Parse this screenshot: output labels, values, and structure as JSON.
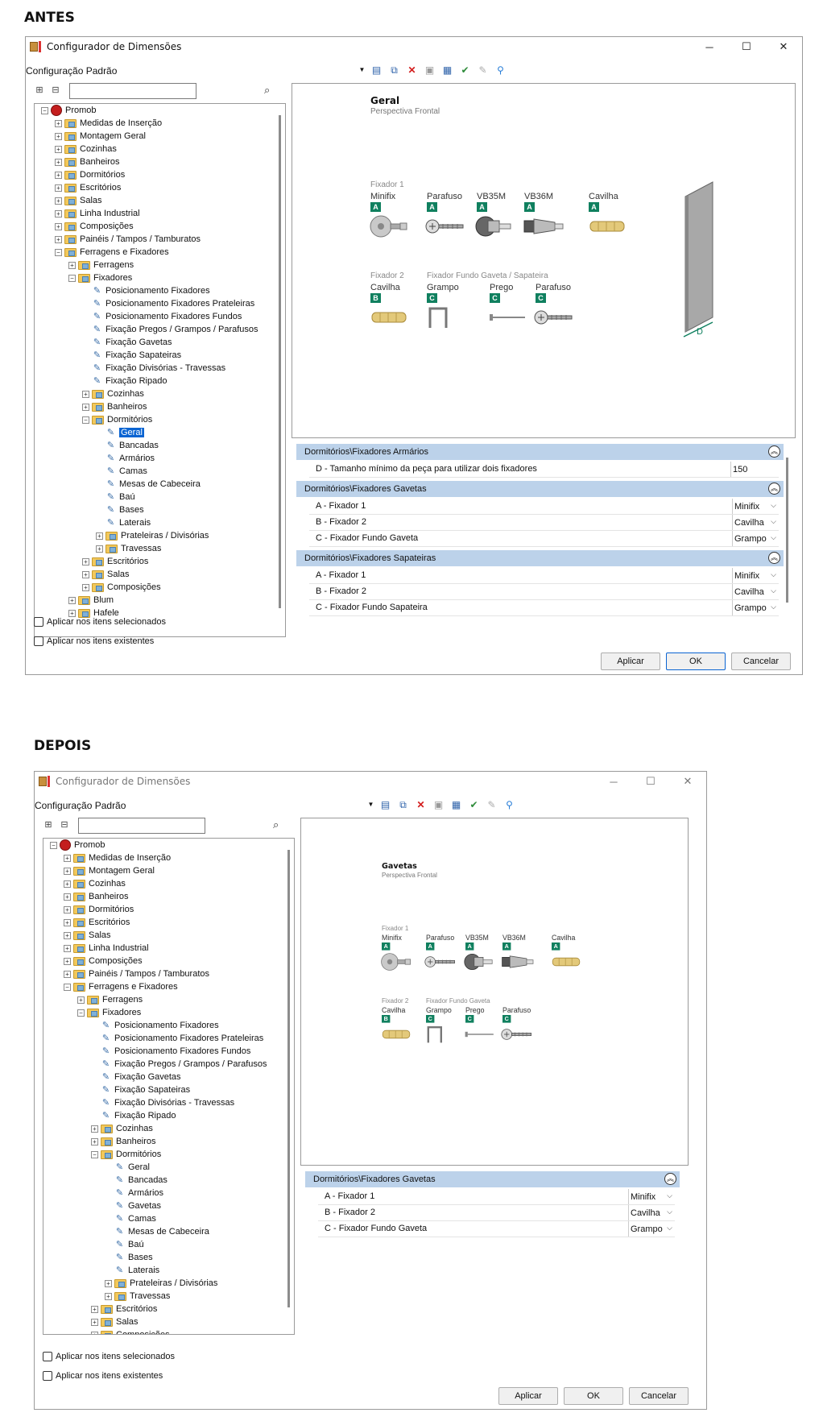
{
  "labels": {
    "before": "ANTES",
    "after": "DEPOIS"
  },
  "before": {
    "title": "Configurador de Dimensões",
    "config": "Configuração Padrão",
    "tree": [
      {
        "label": "Promob",
        "level": 0,
        "icon": "root",
        "exp": "-"
      },
      {
        "label": "Medidas de Inserção",
        "level": 1,
        "icon": "folder",
        "exp": "+"
      },
      {
        "label": "Montagem Geral",
        "level": 1,
        "icon": "folder",
        "exp": "+"
      },
      {
        "label": "Cozinhas",
        "level": 1,
        "icon": "folder",
        "exp": "+"
      },
      {
        "label": "Banheiros",
        "level": 1,
        "icon": "folder",
        "exp": "+"
      },
      {
        "label": "Dormitórios",
        "level": 1,
        "icon": "folder",
        "exp": "+"
      },
      {
        "label": "Escritórios",
        "level": 1,
        "icon": "folder",
        "exp": "+"
      },
      {
        "label": "Salas",
        "level": 1,
        "icon": "folder",
        "exp": "+"
      },
      {
        "label": "Linha Industrial",
        "level": 1,
        "icon": "folder",
        "exp": "+"
      },
      {
        "label": "Composições",
        "level": 1,
        "icon": "folder",
        "exp": "+"
      },
      {
        "label": "Painéis / Tampos / Tamburatos",
        "level": 1,
        "icon": "folder",
        "exp": "+"
      },
      {
        "label": "Ferragens e Fixadores",
        "level": 1,
        "icon": "folder",
        "exp": "-"
      },
      {
        "label": "Ferragens",
        "level": 2,
        "icon": "folder",
        "exp": "+"
      },
      {
        "label": "Fixadores",
        "level": 2,
        "icon": "folder",
        "exp": "-"
      },
      {
        "label": "Posicionamento Fixadores",
        "level": 3,
        "icon": "clip"
      },
      {
        "label": "Posicionamento Fixadores Prateleiras",
        "level": 3,
        "icon": "clip"
      },
      {
        "label": "Posicionamento Fixadores Fundos",
        "level": 3,
        "icon": "clip"
      },
      {
        "label": "Fixação Pregos / Grampos / Parafusos",
        "level": 3,
        "icon": "clip"
      },
      {
        "label": "Fixação Gavetas",
        "level": 3,
        "icon": "clip"
      },
      {
        "label": "Fixação Sapateiras",
        "level": 3,
        "icon": "clip"
      },
      {
        "label": "Fixação Divisórias - Travessas",
        "level": 3,
        "icon": "clip"
      },
      {
        "label": "Fixação Ripado",
        "level": 3,
        "icon": "clip"
      },
      {
        "label": "Cozinhas",
        "level": 3,
        "icon": "folder",
        "exp": "+"
      },
      {
        "label": "Banheiros",
        "level": 3,
        "icon": "folder",
        "exp": "+"
      },
      {
        "label": "Dormitórios",
        "level": 3,
        "icon": "folder",
        "exp": "-"
      },
      {
        "label": "Geral",
        "level": 4,
        "icon": "clip",
        "selected": true
      },
      {
        "label": "Bancadas",
        "level": 4,
        "icon": "clip"
      },
      {
        "label": "Armários",
        "level": 4,
        "icon": "clip"
      },
      {
        "label": "Camas",
        "level": 4,
        "icon": "clip"
      },
      {
        "label": "Mesas de Cabeceira",
        "level": 4,
        "icon": "clip"
      },
      {
        "label": "Baú",
        "level": 4,
        "icon": "clip"
      },
      {
        "label": "Bases",
        "level": 4,
        "icon": "clip"
      },
      {
        "label": "Laterais",
        "level": 4,
        "icon": "clip"
      },
      {
        "label": "Prateleiras / Divisórias",
        "level": 4,
        "icon": "folder",
        "exp": "+"
      },
      {
        "label": "Travessas",
        "level": 4,
        "icon": "folder",
        "exp": "+"
      },
      {
        "label": "Escritórios",
        "level": 3,
        "icon": "folder",
        "exp": "+"
      },
      {
        "label": "Salas",
        "level": 3,
        "icon": "folder",
        "exp": "+"
      },
      {
        "label": "Composições",
        "level": 3,
        "icon": "folder",
        "exp": "+"
      },
      {
        "label": "Blum",
        "level": 2,
        "icon": "folder",
        "exp": "+"
      },
      {
        "label": "Hafele",
        "level": 2,
        "icon": "folder",
        "exp": "+"
      }
    ],
    "chk1": "Aplicar nos itens selecionados",
    "chk2": "Aplicar nos itens existentes",
    "preview": {
      "title": "Geral",
      "subtitle": "Perspectiva Frontal",
      "row1": [
        {
          "top": "Fixador 1",
          "name": "Minifix",
          "badge": "A",
          "part": "minifix"
        },
        {
          "name": "Parafuso",
          "badge": "A",
          "part": "screw"
        },
        {
          "name": "VB35M",
          "badge": "A",
          "part": "vb35"
        },
        {
          "name": "VB36M",
          "badge": "A",
          "part": "vb36"
        },
        {
          "name": "Cavilha",
          "badge": "A",
          "part": "dowel"
        }
      ],
      "row2_header": "Fixador Fundo Gaveta / Sapateira",
      "row2": [
        {
          "top": "Fixador 2",
          "name": "Cavilha",
          "badge": "B",
          "part": "dowel"
        },
        {
          "name": "Grampo",
          "badge": "C",
          "part": "staple"
        },
        {
          "name": "Prego",
          "badge": "C",
          "part": "nail"
        },
        {
          "name": "Parafuso",
          "badge": "C",
          "part": "screw"
        }
      ],
      "dim_label": "D"
    },
    "groups": [
      {
        "title": "Dormitórios\\Fixadores Armários",
        "rows": [
          {
            "name": "D - Tamanho mínimo da peça para utilizar dois fixadores",
            "value": "150",
            "dropdown": false
          }
        ]
      },
      {
        "title": "Dormitórios\\Fixadores Gavetas",
        "rows": [
          {
            "name": "A - Fixador 1",
            "value": "Minifix",
            "dropdown": true
          },
          {
            "name": "B - Fixador 2",
            "value": "Cavilha",
            "dropdown": true
          },
          {
            "name": "C - Fixador Fundo Gaveta",
            "value": "Grampo",
            "dropdown": true
          }
        ]
      },
      {
        "title": "Dormitórios\\Fixadores Sapateiras",
        "rows": [
          {
            "name": "A - Fixador 1",
            "value": "Minifix",
            "dropdown": true
          },
          {
            "name": "B - Fixador 2",
            "value": "Cavilha",
            "dropdown": true
          },
          {
            "name": "C - Fixador Fundo Sapateira",
            "value": "Grampo",
            "dropdown": true
          }
        ]
      }
    ],
    "buttons": {
      "apply": "Aplicar",
      "ok": "OK",
      "cancel": "Cancelar"
    }
  },
  "after": {
    "title": "Configurador de Dimensões",
    "config": "Configuração Padrão",
    "tree": [
      {
        "label": "Promob",
        "level": 0,
        "icon": "root",
        "exp": "-"
      },
      {
        "label": "Medidas de Inserção",
        "level": 1,
        "icon": "folder",
        "exp": "+"
      },
      {
        "label": "Montagem Geral",
        "level": 1,
        "icon": "folder",
        "exp": "+"
      },
      {
        "label": "Cozinhas",
        "level": 1,
        "icon": "folder",
        "exp": "+"
      },
      {
        "label": "Banheiros",
        "level": 1,
        "icon": "folder",
        "exp": "+"
      },
      {
        "label": "Dormitórios",
        "level": 1,
        "icon": "folder",
        "exp": "+"
      },
      {
        "label": "Escritórios",
        "level": 1,
        "icon": "folder",
        "exp": "+"
      },
      {
        "label": "Salas",
        "level": 1,
        "icon": "folder",
        "exp": "+"
      },
      {
        "label": "Linha Industrial",
        "level": 1,
        "icon": "folder",
        "exp": "+"
      },
      {
        "label": "Composições",
        "level": 1,
        "icon": "folder",
        "exp": "+"
      },
      {
        "label": "Painéis / Tampos / Tamburatos",
        "level": 1,
        "icon": "folder",
        "exp": "+"
      },
      {
        "label": "Ferragens e Fixadores",
        "level": 1,
        "icon": "folder",
        "exp": "-"
      },
      {
        "label": "Ferragens",
        "level": 2,
        "icon": "folder",
        "exp": "+"
      },
      {
        "label": "Fixadores",
        "level": 2,
        "icon": "folder",
        "exp": "-"
      },
      {
        "label": "Posicionamento Fixadores",
        "level": 3,
        "icon": "clip"
      },
      {
        "label": "Posicionamento Fixadores Prateleiras",
        "level": 3,
        "icon": "clip"
      },
      {
        "label": "Posicionamento Fixadores Fundos",
        "level": 3,
        "icon": "clip"
      },
      {
        "label": "Fixação Pregos / Grampos / Parafusos",
        "level": 3,
        "icon": "clip"
      },
      {
        "label": "Fixação Gavetas",
        "level": 3,
        "icon": "clip"
      },
      {
        "label": "Fixação Sapateiras",
        "level": 3,
        "icon": "clip"
      },
      {
        "label": "Fixação Divisórias - Travessas",
        "level": 3,
        "icon": "clip"
      },
      {
        "label": "Fixação Ripado",
        "level": 3,
        "icon": "clip"
      },
      {
        "label": "Cozinhas",
        "level": 3,
        "icon": "folder",
        "exp": "+"
      },
      {
        "label": "Banheiros",
        "level": 3,
        "icon": "folder",
        "exp": "+"
      },
      {
        "label": "Dormitórios",
        "level": 3,
        "icon": "folder",
        "exp": "-"
      },
      {
        "label": "Geral",
        "level": 4,
        "icon": "clip"
      },
      {
        "label": "Bancadas",
        "level": 4,
        "icon": "clip"
      },
      {
        "label": "Armários",
        "level": 4,
        "icon": "clip"
      },
      {
        "label": "Gavetas",
        "level": 4,
        "icon": "clip"
      },
      {
        "label": "Camas",
        "level": 4,
        "icon": "clip"
      },
      {
        "label": "Mesas de Cabeceira",
        "level": 4,
        "icon": "clip"
      },
      {
        "label": "Baú",
        "level": 4,
        "icon": "clip"
      },
      {
        "label": "Bases",
        "level": 4,
        "icon": "clip"
      },
      {
        "label": "Laterais",
        "level": 4,
        "icon": "clip"
      },
      {
        "label": "Prateleiras / Divisórias",
        "level": 4,
        "icon": "folder",
        "exp": "+"
      },
      {
        "label": "Travessas",
        "level": 4,
        "icon": "folder",
        "exp": "+"
      },
      {
        "label": "Escritórios",
        "level": 3,
        "icon": "folder",
        "exp": "+"
      },
      {
        "label": "Salas",
        "level": 3,
        "icon": "folder",
        "exp": "+"
      },
      {
        "label": "Composições",
        "level": 3,
        "icon": "folder",
        "exp": "+"
      }
    ],
    "chk1": "Aplicar nos itens selecionados",
    "chk2": "Aplicar nos itens existentes",
    "preview": {
      "title": "Gavetas",
      "subtitle": "Perspectiva Frontal",
      "row1": [
        {
          "top": "Fixador 1",
          "name": "Minifix",
          "badge": "A",
          "part": "minifix"
        },
        {
          "name": "Parafuso",
          "badge": "A",
          "part": "screw"
        },
        {
          "name": "VB35M",
          "badge": "A",
          "part": "vb35"
        },
        {
          "name": "VB36M",
          "badge": "A",
          "part": "vb36"
        },
        {
          "name": "Cavilha",
          "badge": "A",
          "part": "dowel"
        }
      ],
      "row2_header": "Fixador Fundo Gaveta",
      "row2": [
        {
          "top": "Fixador 2",
          "name": "Cavilha",
          "badge": "B",
          "part": "dowel"
        },
        {
          "name": "Grampo",
          "badge": "C",
          "part": "staple"
        },
        {
          "name": "Prego",
          "badge": "C",
          "part": "nail"
        },
        {
          "name": "Parafuso",
          "badge": "C",
          "part": "screw"
        }
      ]
    },
    "groups": [
      {
        "title": "Dormitórios\\Fixadores Gavetas",
        "rows": [
          {
            "name": "A - Fixador 1",
            "value": "Minifix",
            "dropdown": true
          },
          {
            "name": "B - Fixador 2",
            "value": "Cavilha",
            "dropdown": true
          },
          {
            "name": "C - Fixador Fundo Gaveta",
            "value": "Grampo",
            "dropdown": true
          }
        ]
      }
    ],
    "buttons": {
      "apply": "Aplicar",
      "ok": "OK",
      "cancel": "Cancelar"
    }
  }
}
